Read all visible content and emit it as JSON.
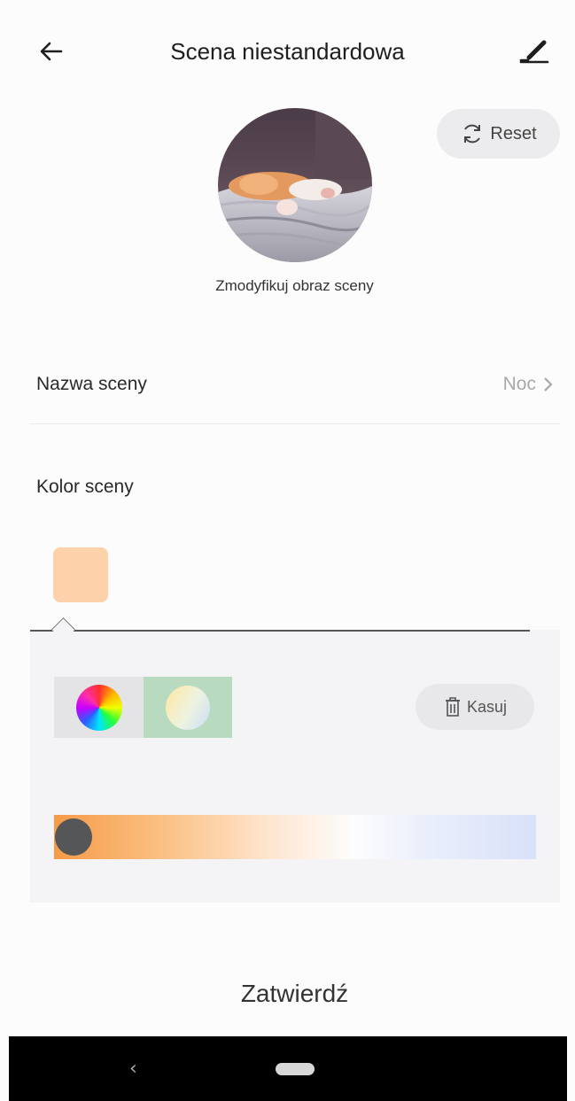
{
  "header": {
    "title": "Scena niestandardowa",
    "back_icon": "arrow-left-icon",
    "edit_icon": "pencil-icon"
  },
  "scene_image": {
    "modify_label": "Zmodyfikuj obraz sceny"
  },
  "reset_button": {
    "label": "Reset",
    "icon": "refresh-icon"
  },
  "scene_name": {
    "label": "Nazwa sceny",
    "value": "Noc"
  },
  "scene_color": {
    "label": "Kolor sceny",
    "swatch_color": "#fdd2ab",
    "modes": [
      "color-wheel",
      "white-temperature"
    ],
    "selected_mode": "white-temperature",
    "delete_label": "Kasuj",
    "temperature_level": 0.0
  },
  "confirm_button": {
    "label": "Zatwierdź"
  },
  "colors": {
    "accent_selected": "#b8dbc0",
    "panel_bg": "#f4f4f6"
  }
}
